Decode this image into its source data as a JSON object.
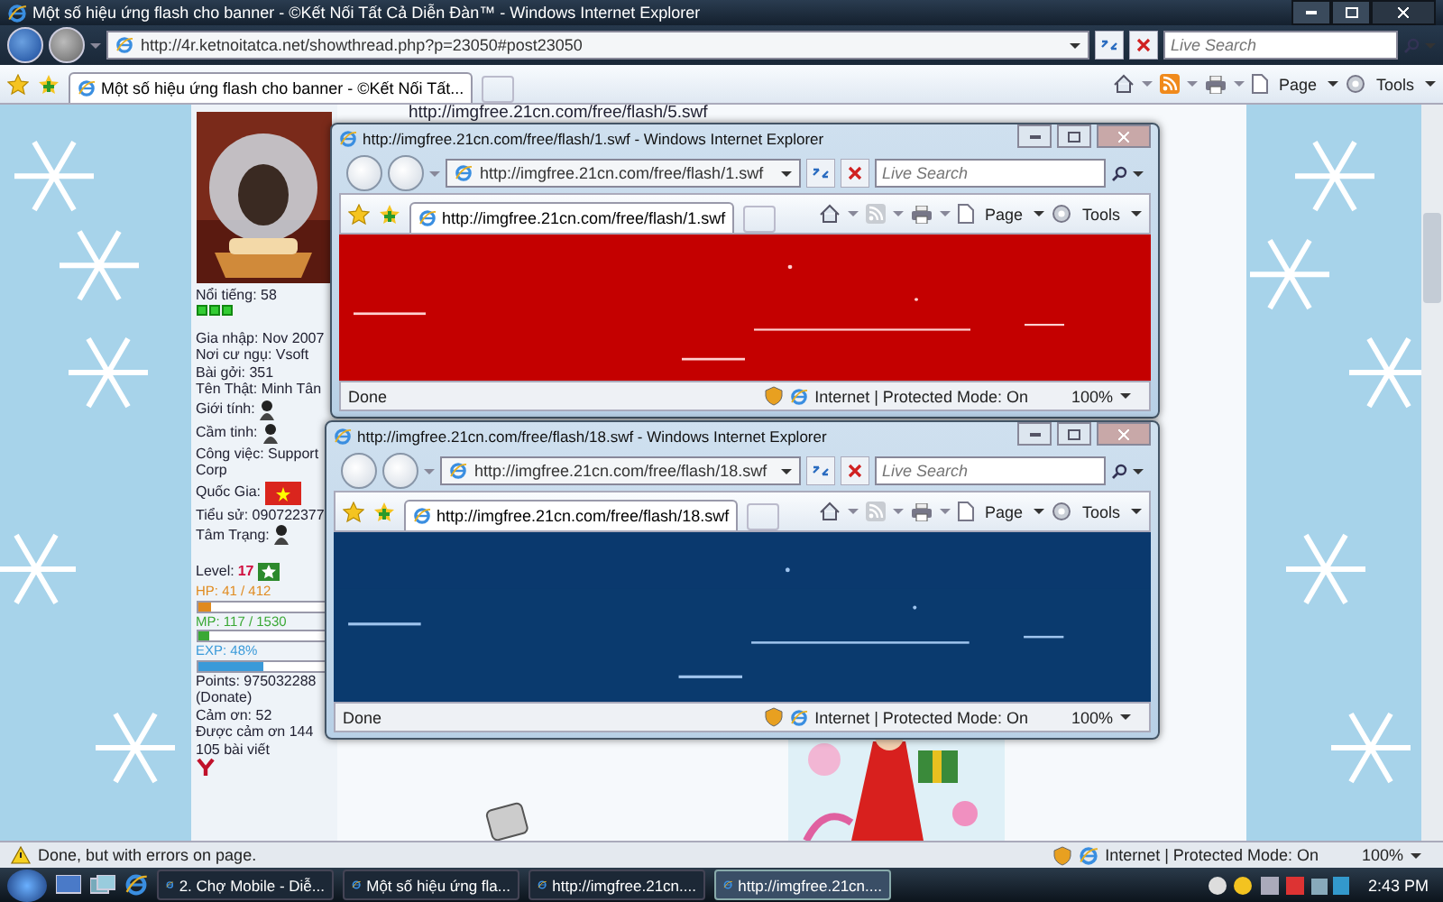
{
  "window": {
    "title": "Một số hiệu ứng flash cho banner - ©Kết Nối Tất Cả Diễn Đàn™ - Windows Internet Explorer",
    "address": "http://4r.ketnoitatca.net/showthread.php?p=23050#post23050",
    "search_placeholder": "Live Search",
    "tab": "Một số hiệu ứng flash cho banner - ©Kết Nối Tất...",
    "toolbar": [
      "Page",
      "Tools"
    ]
  },
  "page": {
    "top_link": "http://imgfree.21cn.com/free/flash/5.swf",
    "profile": [
      {
        "kind": "text",
        "text": "Nổi tiếng: 58"
      },
      {
        "kind": "reputation"
      },
      {
        "kind": "gap"
      },
      {
        "kind": "text",
        "text": "Gia nhập: Nov 2007"
      },
      {
        "kind": "text",
        "text": "Nơi cư ngụ: Vsoft"
      },
      {
        "kind": "text",
        "text": "Bài gởi: 351"
      },
      {
        "kind": "text",
        "text": "Tên Thật: Minh Tân"
      },
      {
        "kind": "icon",
        "text": "Giới tính:"
      },
      {
        "kind": "icon",
        "text": "Cầm tinh:"
      },
      {
        "kind": "text",
        "text": "Công việc: Support"
      },
      {
        "kind": "text",
        "text": "Corp"
      },
      {
        "kind": "flag",
        "text": "Quốc Gia:"
      },
      {
        "kind": "text",
        "text": "Tiểu sử: 090722377"
      },
      {
        "kind": "icon",
        "text": "Tâm Trạng:"
      },
      {
        "kind": "gap"
      },
      {
        "kind": "level",
        "text": "Level:",
        "value": "17"
      },
      {
        "kind": "bar",
        "text": "HP: 41 / 412",
        "level": 0.1,
        "color": "#e08a1e"
      },
      {
        "kind": "bar",
        "text": "MP: 117 / 1530",
        "level": 0.08,
        "color": "#3aa835"
      },
      {
        "kind": "bar",
        "text": "EXP: 48%",
        "level": 0.48,
        "color": "#3a9ad9"
      },
      {
        "kind": "text",
        "text": "Points: 975032288"
      },
      {
        "kind": "text",
        "text": "(Donate)"
      },
      {
        "kind": "text",
        "text": "Cảm ơn: 52"
      },
      {
        "kind": "text",
        "text": "Được cảm ơn 144"
      },
      {
        "kind": "text",
        "text": "105 bài viết"
      }
    ]
  },
  "popups": [
    {
      "title": "http://imgfree.21cn.com/free/flash/1.swf - Windows Internet Explorer",
      "address": "http://imgfree.21cn.com/free/flash/1.swf",
      "search_placeholder": "Live Search",
      "tab": "http://imgfree.21cn.com/free/flash/1.swf",
      "toolbar": [
        "Page",
        "Tools"
      ],
      "status": "Done",
      "zone": "Internet | Protected Mode: On",
      "zoom": "100%"
    },
    {
      "title": "http://imgfree.21cn.com/free/flash/18.swf - Windows Internet Explorer",
      "address": "http://imgfree.21cn.com/free/flash/18.swf",
      "search_placeholder": "Live Search",
      "tab": "http://imgfree.21cn.com/free/flash/18.swf",
      "toolbar": [
        "Page",
        "Tools"
      ],
      "status": "Done",
      "zone": "Internet | Protected Mode: On",
      "zoom": "100%"
    }
  ],
  "status_bar": {
    "text": "Done, but with errors on page.",
    "zone": "Internet | Protected Mode: On",
    "zoom": "100%"
  },
  "taskbar": {
    "buttons": [
      {
        "label": "2. Chợ Mobile - Diễ...",
        "selected": false
      },
      {
        "label": "Một số hiệu ứng fla...",
        "selected": false
      },
      {
        "label": "http://imgfree.21cn....",
        "selected": false
      },
      {
        "label": "http://imgfree.21cn....",
        "selected": true
      }
    ],
    "clock": "2:43 PM"
  }
}
